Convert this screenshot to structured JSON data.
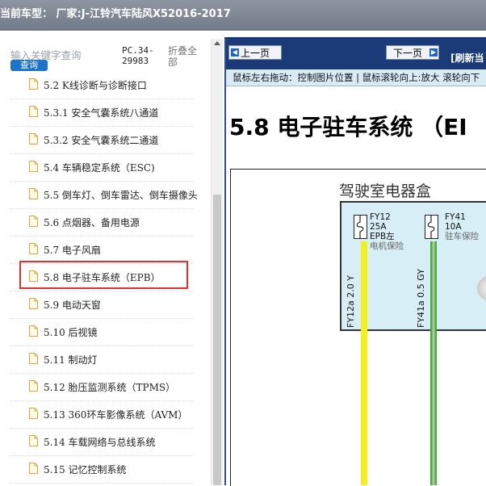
{
  "header": {
    "title": "当前车型： 厂家:J-江铃汽车陆风X52016-2017"
  },
  "sidebar": {
    "search_placeholder": "输入关键字查询",
    "search_button": "查询",
    "pc_code": "PC.34-29983",
    "collapse_all": "折叠全部",
    "items": [
      {
        "label": "5.2 K线诊断与诊断接口"
      },
      {
        "label": "5.3.1 安全气囊系统八通道"
      },
      {
        "label": "5.3.2 安全气囊系统二通道"
      },
      {
        "label": "5.4 车辆稳定系统（ESC)"
      },
      {
        "label": "5.5 倒车灯、倒车雷达、倒车摄像头"
      },
      {
        "label": "5.6 点烟器、备用电源"
      },
      {
        "label": "5.7 电子风扇"
      },
      {
        "label": "5.8 电子驻车系统（EPB）"
      },
      {
        "label": "5.9 电动天窗"
      },
      {
        "label": "5.10 后视镜"
      },
      {
        "label": "5.11 制动灯"
      },
      {
        "label": "5.12 胎压监测系统（TPMS）"
      },
      {
        "label": "5.13 360环车影像系统（AVM）"
      },
      {
        "label": "5.14 车载网络与总线系统"
      },
      {
        "label": "5.15 记忆控制系统"
      }
    ],
    "selected_index": 7
  },
  "viewer": {
    "prev_button": "上一页",
    "next_button": "下一页",
    "refresh": "[刷新当",
    "hint": "鼠标左右拖动：控制图片位置 | 鼠标滚轮向上:放大  滚轮向下",
    "doc_title": "5.8 电子驻车系统 （EI",
    "diagram": {
      "box_title": "驾驶室电器盒",
      "fuses": [
        {
          "code": "FY12",
          "rating": "25A",
          "desc_line1": "EPB左",
          "desc_line2": "电机保险"
        },
        {
          "code": "FY41",
          "rating": "10A",
          "desc_line1": "驻车保险",
          "desc_line2": ""
        }
      ],
      "wires": [
        {
          "label": "FY12a  2.0  Y",
          "color": "#f5f01c"
        },
        {
          "label": "FY41a  0.5  GY",
          "color": "#3fb23a"
        }
      ]
    }
  },
  "colors": {
    "topbar": "#7d8491",
    "nav_bg": "#1a3a78",
    "hint_bg": "#d9ecf6",
    "highlight": "#e03030",
    "fuse_box_bg": "#d8eef6"
  }
}
